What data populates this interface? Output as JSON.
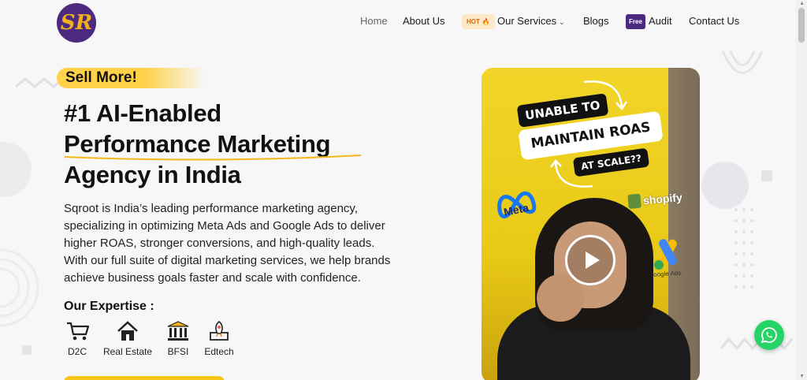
{
  "logo": {
    "monogram": "SR"
  },
  "nav": {
    "home": "Home",
    "about": "About Us",
    "hot_badge": "HOT",
    "services": "Our Services",
    "blogs": "Blogs",
    "free_badge": "Free",
    "audit": "Audit",
    "contact": "Contact Us"
  },
  "hero": {
    "tag": "Sell More!",
    "title_lines": [
      "#1 AI-Enabled",
      "Performance Marketing",
      "Agency in India"
    ],
    "description_lines": [
      "Sqroot is India’s leading performance marketing agency,",
      "specializing in optimizing Meta Ads and Google Ads to deliver",
      "higher ROAS, stronger conversions, and high-quality leads.",
      "With our full suite of digital marketing services, we help brands",
      "achieve business goals faster and scale with confidence."
    ]
  },
  "expertise": {
    "title": "Our Expertise :",
    "items": [
      {
        "label": "D2C",
        "icon": "cart-icon"
      },
      {
        "label": "Real Estate",
        "icon": "house-icon"
      },
      {
        "label": "BFSI",
        "icon": "bank-icon"
      },
      {
        "label": "Edtech",
        "icon": "rocket-icon"
      }
    ]
  },
  "video": {
    "pill_1": "UNABLE TO",
    "pill_2": "MAINTAIN ROAS",
    "pill_3": "AT SCALE??",
    "meta_label": "Meta",
    "shopify_label": "shopify",
    "google_ads_label": "Google Ads"
  },
  "colors": {
    "brand_purple": "#4b2a7f",
    "accent_yellow": "#ffd24a",
    "whatsapp_green": "#25d366"
  }
}
